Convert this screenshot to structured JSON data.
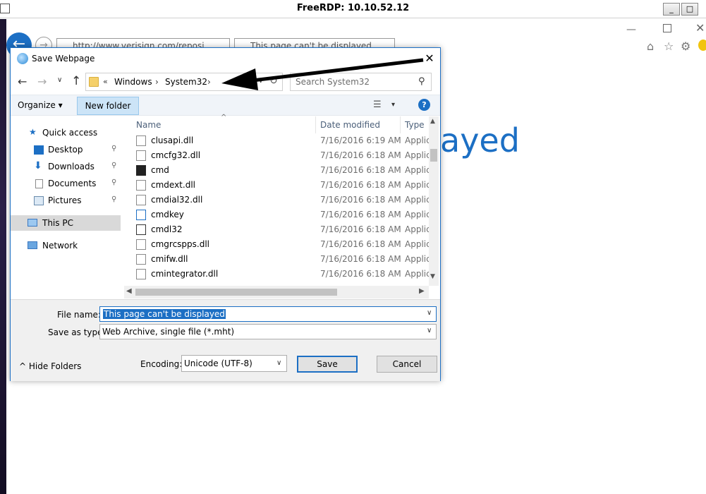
{
  "rdp": {
    "title": "FreeRDP: 10.10.52.12",
    "min_label": "_",
    "max_label": "□",
    "close_label": "X"
  },
  "browser": {
    "back_glyph": "←",
    "fwd_glyph": "→",
    "address": "http://www.verisign.com/reposi",
    "tab_title": "This page can't be displayed",
    "heading_visible": "ayed",
    "win_min_glyph": "—",
    "win_close_glyph": "✕"
  },
  "dialog": {
    "title": "Save Webpage",
    "close_glyph": "✕",
    "breadcrumbs": [
      "Windows",
      "System32"
    ],
    "breadcrumb_overflow": "«",
    "search_placeholder": "Search System32",
    "toolbar": {
      "organize": "Organize ▾",
      "new_folder": "New folder",
      "help": "?"
    },
    "nav": [
      {
        "label": "Quick access"
      },
      {
        "label": "Desktop"
      },
      {
        "label": "Downloads"
      },
      {
        "label": "Documents"
      },
      {
        "label": "Pictures"
      },
      {
        "label": "This PC"
      },
      {
        "label": "Network"
      }
    ],
    "columns": {
      "name": "Name",
      "date": "Date modified",
      "type": "Type"
    },
    "files": [
      {
        "name": "clusapi.dll",
        "date": "7/16/2016 6:19 AM",
        "type": "Applic"
      },
      {
        "name": "cmcfg32.dll",
        "date": "7/16/2016 6:18 AM",
        "type": "Applic"
      },
      {
        "name": "cmd",
        "date": "7/16/2016 6:18 AM",
        "type": "Applic"
      },
      {
        "name": "cmdext.dll",
        "date": "7/16/2016 6:18 AM",
        "type": "Applic"
      },
      {
        "name": "cmdial32.dll",
        "date": "7/16/2016 6:18 AM",
        "type": "Applic"
      },
      {
        "name": "cmdkey",
        "date": "7/16/2016 6:18 AM",
        "type": "Applic"
      },
      {
        "name": "cmdl32",
        "date": "7/16/2016 6:18 AM",
        "type": "Applic"
      },
      {
        "name": "cmgrcspps.dll",
        "date": "7/16/2016 6:18 AM",
        "type": "Applic"
      },
      {
        "name": "cmifw.dll",
        "date": "7/16/2016 6:18 AM",
        "type": "Applic"
      },
      {
        "name": "cmintegrator.dll",
        "date": "7/16/2016 6:18 AM",
        "type": "Applic"
      }
    ],
    "form": {
      "filename_label": "File name:",
      "filename_value": "This page can't be displayed",
      "savetype_label": "Save as type:",
      "savetype_value": "Web Archive, single file (*.mht)",
      "hide_folders": "Hide Folders",
      "encoding_label": "Encoding:",
      "encoding_value": "Unicode (UTF-8)",
      "save": "Save",
      "cancel": "Cancel"
    }
  },
  "colors": {
    "accent": "#1c6fc4",
    "selection": "#cce4f7",
    "arrow": "#000000"
  }
}
